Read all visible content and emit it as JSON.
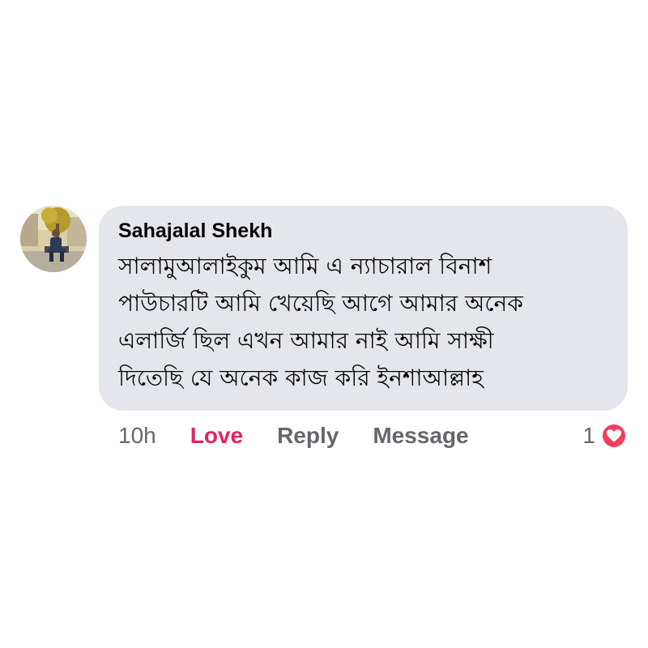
{
  "comment": {
    "author": "Sahajalal Shekh",
    "lines": [
      "সালামুআলাইকুম আমি এ ন্যাচারাল বিনাশ",
      "পাউচারটি আমি খেয়েছি আগে আমার অনেক",
      "এলার্জি ছিল এখন আমার নাই আমি সাক্ষী",
      "দিতেছি যে অনেক কাজ করি ইনশাআল্লাহ"
    ],
    "avatar_icon": "profile-photo"
  },
  "actions": {
    "time": "10h",
    "love_label": "Love",
    "reply_label": "Reply",
    "message_label": "Message"
  },
  "reactions": {
    "count": "1",
    "icon": "heart-icon"
  },
  "colors": {
    "bubble_bg": "#e4e6eb",
    "love": "#e0245e",
    "muted": "#65676b",
    "heart_badge": "#f33e58"
  }
}
